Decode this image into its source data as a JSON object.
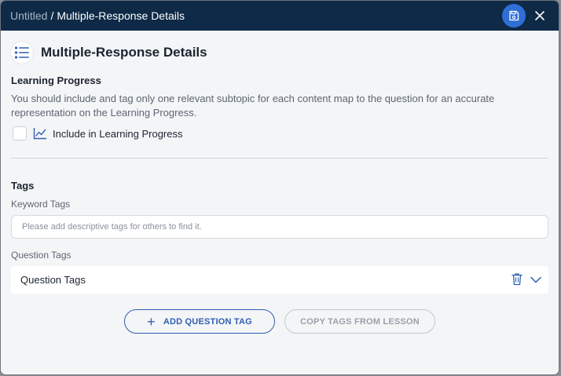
{
  "breadcrumb": {
    "root": "Untitled",
    "separator": "/",
    "current": "Multiple-Response Details"
  },
  "header": {
    "title": "Multiple-Response Details",
    "icon": "list-icon"
  },
  "learning_progress": {
    "title": "Learning Progress",
    "description": "You should include and tag only one relevant subtopic for each content map to the question for an accurate representation on the Learning Progress.",
    "include_label": "Include in Learning Progress",
    "include_checked": false
  },
  "tags": {
    "title": "Tags",
    "keyword_label": "Keyword Tags",
    "keyword_placeholder": "Please add descriptive tags for others to find it.",
    "question_label": "Question Tags",
    "question_box_text": "Question Tags"
  },
  "buttons": {
    "add_question_tag": "ADD QUESTION TAG",
    "copy_tags": "COPY TAGS FROM LESSON"
  },
  "colors": {
    "titlebar": "#0f2a47",
    "accent": "#2f6fd6",
    "background": "#f4f5f7"
  }
}
